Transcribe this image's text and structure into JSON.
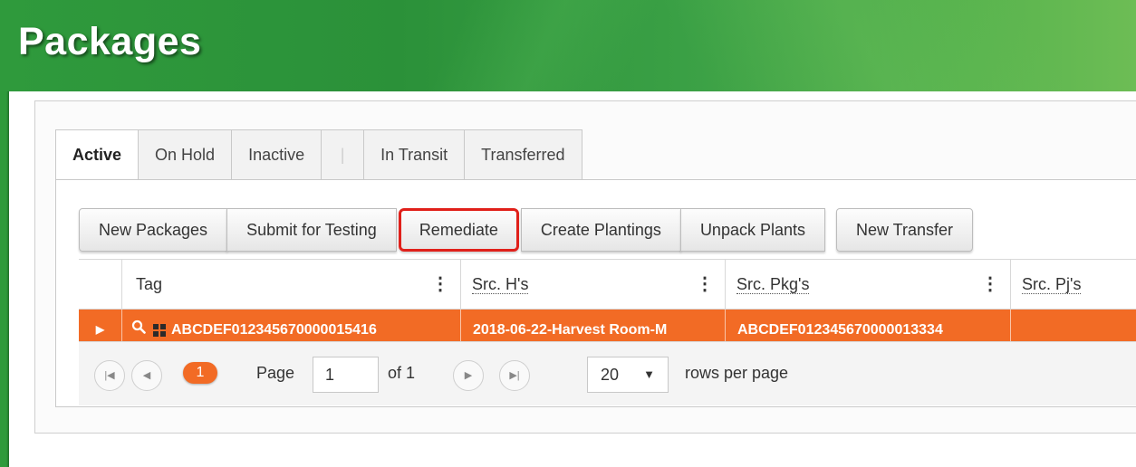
{
  "header": {
    "title": "Packages"
  },
  "tabs": [
    {
      "label": "Active",
      "active": true
    },
    {
      "label": "On Hold"
    },
    {
      "label": "Inactive"
    },
    {
      "label": ""
    },
    {
      "label": "In Transit"
    },
    {
      "label": "Transferred"
    }
  ],
  "toolbar": {
    "new_packages": "New Packages",
    "submit_for_testing": "Submit for Testing",
    "remediate": "Remediate",
    "create_plantings": "Create Plantings",
    "unpack_plants": "Unpack Plants",
    "new_transfer": "New Transfer"
  },
  "grid": {
    "columns": {
      "tag": "Tag",
      "src_h": "Src. H's",
      "src_pkg": "Src. Pkg's",
      "src_pj": "Src. Pj's"
    },
    "rows": [
      {
        "tag": "ABCDEF012345670000015416",
        "src_h": "2018-06-22-Harvest Room-M",
        "src_pkg": "ABCDEF012345670000013334",
        "src_pj": ""
      }
    ]
  },
  "pager": {
    "current_page": "1",
    "page_label": "Page",
    "page_input": "1",
    "of_label": "of 1",
    "rows_per_page_value": "20",
    "rows_per_page_label": "rows per page"
  },
  "colors": {
    "header_green": "#2f9a3c",
    "selected_row": "#f26b25",
    "highlight_outline": "#e0201a"
  }
}
